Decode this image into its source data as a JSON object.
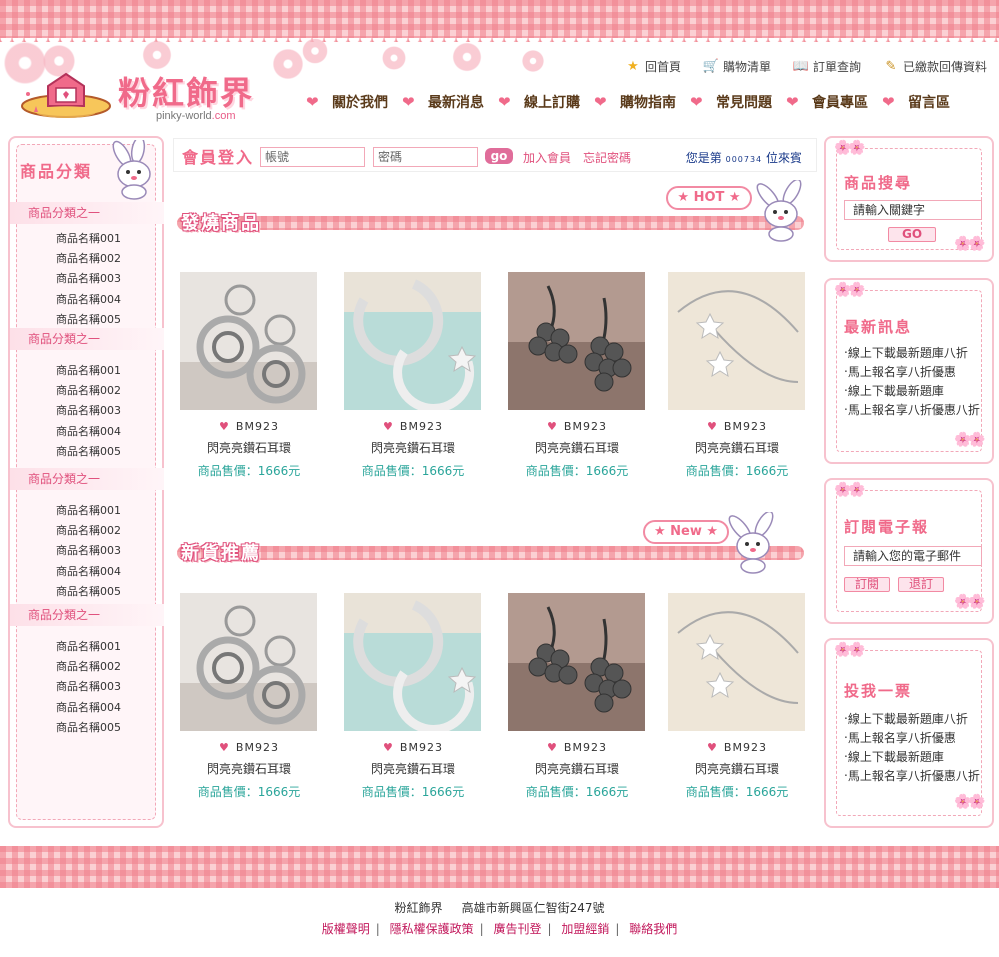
{
  "header": {
    "logo_title": "粉紅飾界",
    "logo_sub": "pinky-world",
    "logo_sub_suffix": ".com",
    "util_nav": [
      {
        "label": "回首頁",
        "icon": "star-icon"
      },
      {
        "label": "購物清單",
        "icon": "cart-icon"
      },
      {
        "label": "訂單查詢",
        "icon": "book-icon"
      },
      {
        "label": "已繳款回傳資料",
        "icon": "pencil-icon"
      }
    ],
    "main_nav": [
      "關於我們",
      "最新消息",
      "線上訂購",
      "購物指南",
      "常見問題",
      "會員專區",
      "留言區"
    ]
  },
  "left_sidebar": {
    "title": "商品分類",
    "categories": [
      {
        "name": "商品分類之一",
        "items": [
          "商品名稱001",
          "商品名稱002",
          "商品名稱003",
          "商品名稱004",
          "商品名稱005"
        ]
      },
      {
        "name": "商品分類之一",
        "items": [
          "商品名稱001",
          "商品名稱002",
          "商品名稱003",
          "商品名稱004",
          "商品名稱005"
        ]
      },
      {
        "name": "商品分類之一",
        "items": [
          "商品名稱001",
          "商品名稱002",
          "商品名稱003",
          "商品名稱004",
          "商品名稱005"
        ]
      },
      {
        "name": "商品分類之一",
        "items": [
          "商品名稱001",
          "商品名稱002",
          "商品名稱003",
          "商品名稱004",
          "商品名稱005"
        ]
      }
    ]
  },
  "login": {
    "title": "會員登入",
    "account_placeholder": "帳號",
    "password_placeholder": "密碼",
    "go_label": "go",
    "join_label": "加入會員",
    "forgot_label": "忘記密碼",
    "visitor_prefix": "您是第",
    "visitor_count": "000734",
    "visitor_suffix": "位來賓"
  },
  "hot_section": {
    "title": "發燒商品",
    "tag": "HOT",
    "products": [
      {
        "code": "BM923",
        "name": "閃亮亮鑽石耳環",
        "price": "商品售價：1666元",
        "image": "silver-ring-earring"
      },
      {
        "code": "BM923",
        "name": "閃亮亮鑽石耳環",
        "price": "商品售價：1666元",
        "image": "moon-star-earring"
      },
      {
        "code": "BM923",
        "name": "閃亮亮鑽石耳環",
        "price": "商品售價：1666元",
        "image": "pearl-cluster-earring"
      },
      {
        "code": "BM923",
        "name": "閃亮亮鑽石耳環",
        "price": "商品售價：1666元",
        "image": "hook-star-earring"
      }
    ]
  },
  "new_section": {
    "title": "新貨推薦",
    "tag": "New",
    "products": [
      {
        "code": "BM923",
        "name": "閃亮亮鑽石耳環",
        "price": "商品售價：1666元",
        "image": "silver-ring-earring"
      },
      {
        "code": "BM923",
        "name": "閃亮亮鑽石耳環",
        "price": "商品售價：1666元",
        "image": "moon-star-earring"
      },
      {
        "code": "BM923",
        "name": "閃亮亮鑽石耳環",
        "price": "商品售價：1666元",
        "image": "pearl-cluster-earring"
      },
      {
        "code": "BM923",
        "name": "閃亮亮鑽石耳環",
        "price": "商品售價：1666元",
        "image": "hook-star-earring"
      }
    ]
  },
  "right_sidebar": {
    "search": {
      "title": "商品搜尋",
      "input_value": "請輸入關鍵字",
      "button_label": "GO"
    },
    "news": {
      "title": "最新訊息",
      "items": [
        "線上下載最新題庫八折",
        "馬上報名享八折優惠",
        "線上下載最新題庫",
        "馬上報名享八折優惠八折"
      ]
    },
    "newsletter": {
      "title": "訂閱電子報",
      "input_value": "請輸入您的電子郵件",
      "subscribe_label": "訂閱",
      "unsubscribe_label": "退訂"
    },
    "vote": {
      "title": "投我一票",
      "items": [
        "線上下載最新題庫八折",
        "馬上報名享八折優惠",
        "線上下載最新題庫",
        "馬上報名享八折優惠八折"
      ]
    }
  },
  "footer": {
    "site_name": "粉紅飾界",
    "address": "高雄市新興區仁智街247號",
    "links": [
      "版權聲明",
      "隱私權保護政策",
      "廣告刊登",
      "加盟經銷",
      "聯絡我們"
    ]
  },
  "colors": {
    "accent_pink": "#f06a8a",
    "price_teal": "#2aa59a",
    "link_magenta": "#c2185b"
  }
}
